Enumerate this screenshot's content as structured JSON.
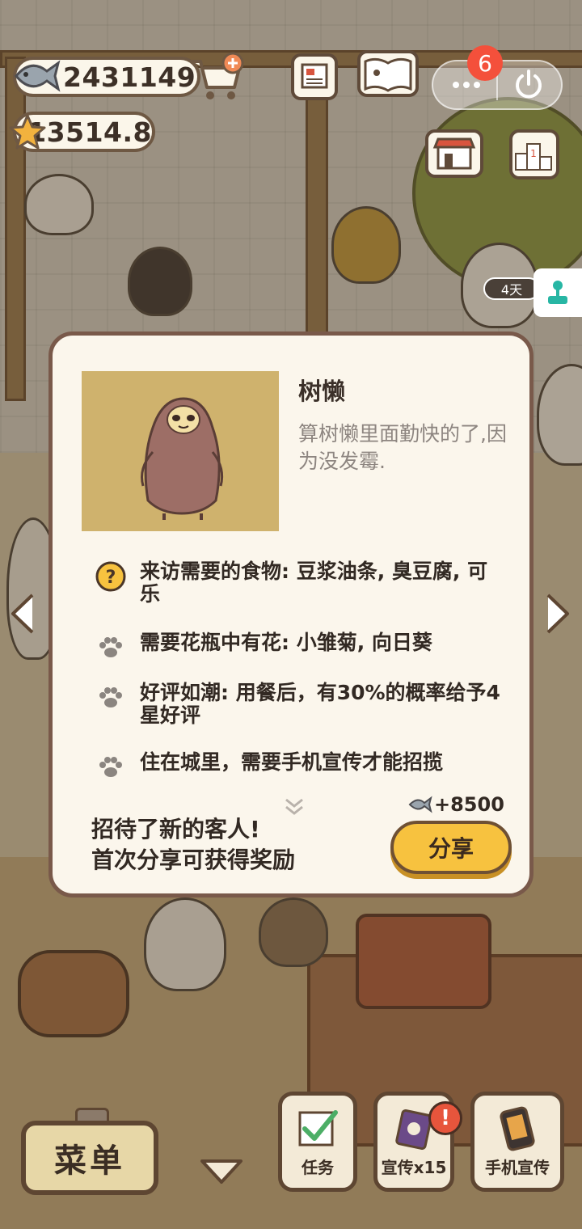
{
  "hud": {
    "fish_currency": "2431149",
    "star_currency": "13514.8",
    "notification_count": "6",
    "event_days": "4天"
  },
  "dialog": {
    "name": "树懒",
    "description": "算树懒里面勤快的了,因为没发霉.",
    "requirements": [
      {
        "icon": "question-icon",
        "text": "来访需要的食物: 豆浆油条, 臭豆腐, 可乐"
      },
      {
        "icon": "paw-icon",
        "text": "需要花瓶中有花: 小雏菊, 向日葵"
      },
      {
        "icon": "paw-icon",
        "text": "好评如潮: 用餐后，有30%的概率给予4星好评"
      },
      {
        "icon": "paw-icon",
        "text": "住在城里，需要手机宣传才能招揽"
      }
    ],
    "reward": "+8500",
    "footer_line1": "招待了新的客人!",
    "footer_line2": "首次分享可获得奖励",
    "share_label": "分享"
  },
  "bottom_bar": {
    "menu_label": "菜单",
    "task_label": "任务",
    "promo_label": "宣传x15",
    "phone_promo_label": "手机宣传"
  },
  "colors": {
    "dialog_bg": "#fbf6ec",
    "dialog_border": "#79594a",
    "share_button": "#f7c23f",
    "badge_red": "#f4503b",
    "portrait_bg": "#cfb26d"
  }
}
